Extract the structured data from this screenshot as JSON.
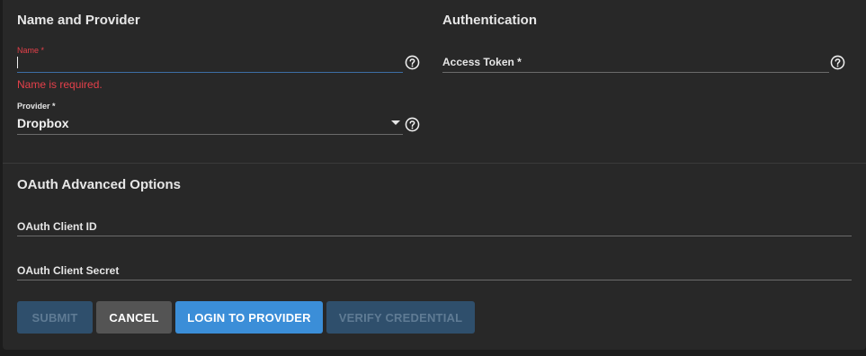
{
  "sections": {
    "name_provider_title": "Name and Provider",
    "authentication_title": "Authentication",
    "oauth_title": "OAuth Advanced Options"
  },
  "fields": {
    "name": {
      "label": "Name *",
      "value": "",
      "error": "Name is required."
    },
    "provider": {
      "label": "Provider *",
      "value": "Dropbox"
    },
    "access_token": {
      "label": "Access Token *",
      "value": ""
    },
    "oauth_client_id": {
      "label": "OAuth Client ID",
      "value": ""
    },
    "oauth_client_secret": {
      "label": "OAuth Client Secret",
      "value": ""
    }
  },
  "buttons": {
    "submit": "SUBMIT",
    "cancel": "CANCEL",
    "login": "LOGIN TO PROVIDER",
    "verify": "VERIFY CREDENTIAL"
  },
  "icons": {
    "help": "help-circle-icon",
    "dropdown": "caret-down-icon"
  },
  "colors": {
    "background": "#282828",
    "error": "#e5404a",
    "primary": "#3b8ed8",
    "disabled": "#2f4f6c"
  }
}
